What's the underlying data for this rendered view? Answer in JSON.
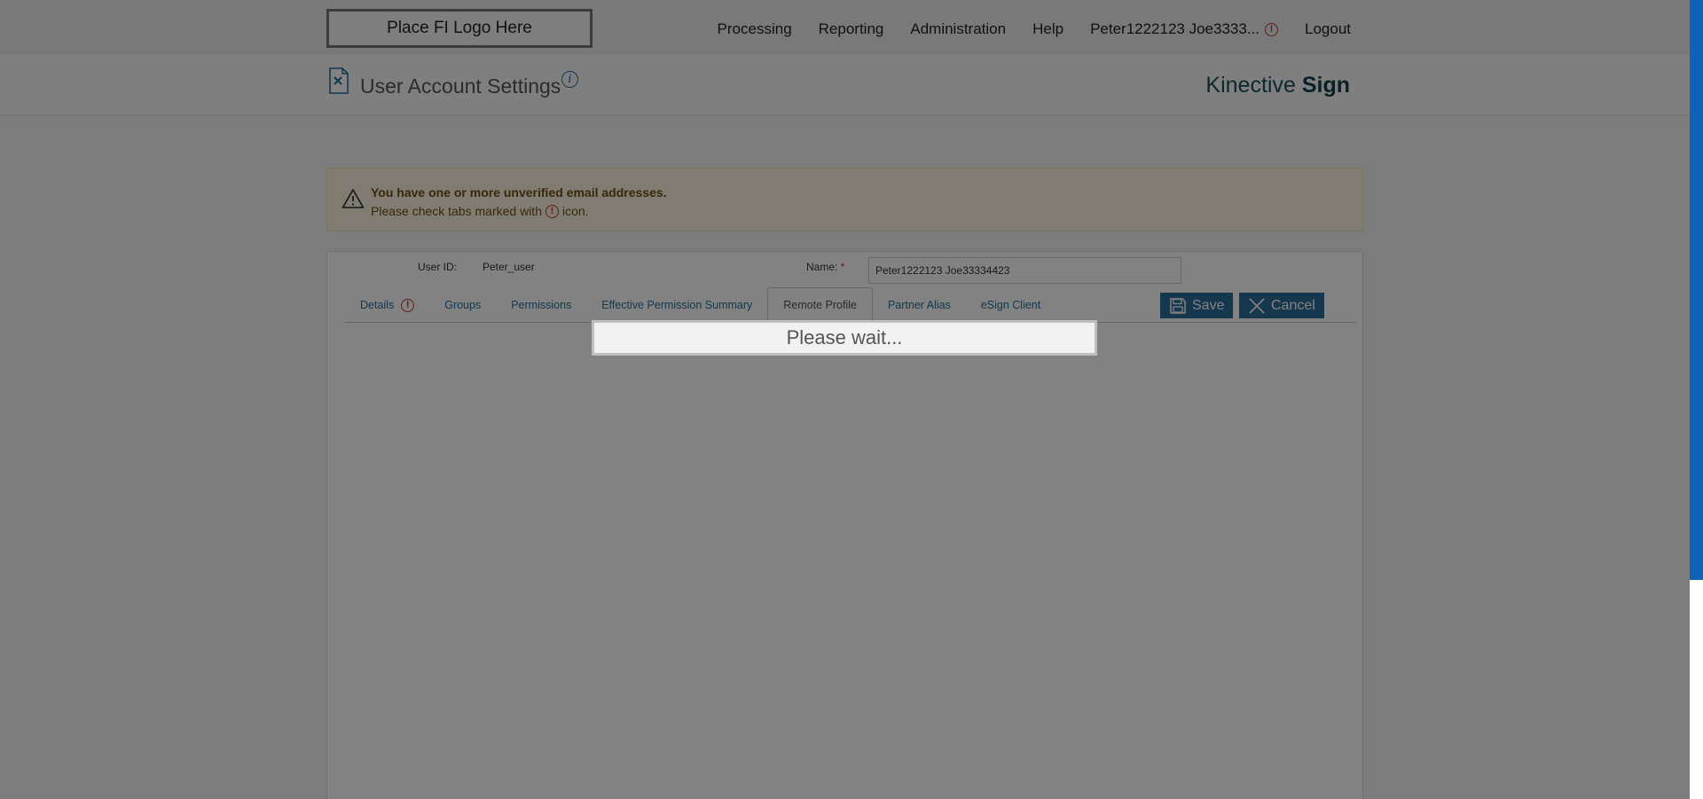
{
  "header": {
    "logo_text": "Place FI Logo Here",
    "nav": {
      "processing": "Processing",
      "reporting": "Reporting",
      "administration": "Administration",
      "help": "Help",
      "user": "Peter1222123 Joe3333...",
      "logout": "Logout"
    }
  },
  "subheader": {
    "title": "User Account Settings",
    "info_glyph": "i",
    "brand_light": "Kinective",
    "brand_bold": "Sign"
  },
  "alert": {
    "title": "You have one or more unverified email addresses.",
    "text_before": "Please check tabs marked with",
    "text_after": "icon."
  },
  "form": {
    "user_id_label": "User ID:",
    "user_id_value": "Peter_user",
    "name_label": "Name:",
    "name_required_mark": "*",
    "name_value": "Peter1222123 Joe33334423"
  },
  "tabs": [
    {
      "label": "Details",
      "has_warning": true
    },
    {
      "label": "Groups"
    },
    {
      "label": "Permissions"
    },
    {
      "label": "Effective Permission Summary"
    },
    {
      "label": "Remote Profile",
      "active": true
    },
    {
      "label": "Partner Alias"
    },
    {
      "label": "eSign Client"
    }
  ],
  "buttons": {
    "save": "Save",
    "cancel": "Cancel"
  },
  "overlay": {
    "message": "Please wait..."
  },
  "icons": {
    "warning_glyph": "!"
  },
  "colors": {
    "accent": "#2a6f9a",
    "error": "#c0392b",
    "scrollbar": "#0d63b8",
    "alert_bg": "#fdf4e0"
  }
}
